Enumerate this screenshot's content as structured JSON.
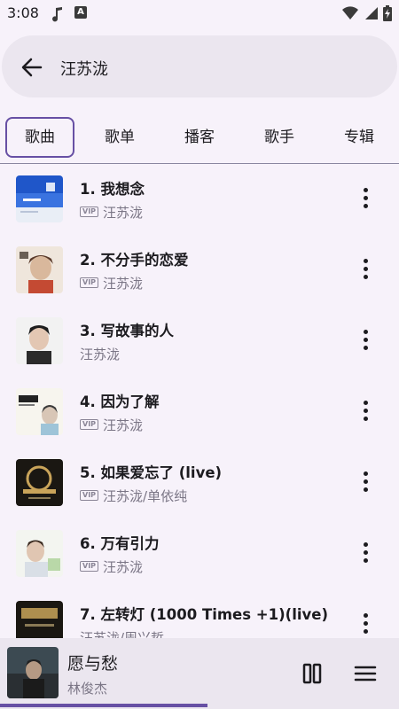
{
  "status_bar": {
    "time": "3:08",
    "icons": [
      "music-note-icon",
      "a-app-icon",
      "wifi-icon",
      "signal-icon",
      "battery-charging-icon"
    ]
  },
  "search": {
    "query": "汪苏泷"
  },
  "tabs": [
    {
      "label": "歌曲",
      "selected": true
    },
    {
      "label": "歌单",
      "selected": false
    },
    {
      "label": "播客",
      "selected": false
    },
    {
      "label": "歌手",
      "selected": false
    },
    {
      "label": "专辑",
      "selected": false
    }
  ],
  "songs": [
    {
      "title": "1. 我想念",
      "vip": true,
      "artist": "汪苏泷"
    },
    {
      "title": "2. 不分手的恋爱",
      "vip": true,
      "artist": "汪苏泷"
    },
    {
      "title": "3. 写故事的人",
      "vip": false,
      "artist": "汪苏泷"
    },
    {
      "title": "4. 因为了解",
      "vip": true,
      "artist": "汪苏泷"
    },
    {
      "title": "5. 如果爱忘了 (live)",
      "vip": true,
      "artist": "汪苏泷/单依纯"
    },
    {
      "title": "6. 万有引力",
      "vip": true,
      "artist": "汪苏泷"
    },
    {
      "title": "7. 左转灯 (1000 Times +1)(live)",
      "vip": false,
      "artist": "汪苏泷/周兴哲"
    }
  ],
  "vip_label": "VIP",
  "now_playing": {
    "title": "愿与愁",
    "artist": "林俊杰",
    "progress": 0.52
  },
  "colors": {
    "accent": "#6750a4",
    "background": "#f7f2fa",
    "surface": "#ebe6ef"
  }
}
